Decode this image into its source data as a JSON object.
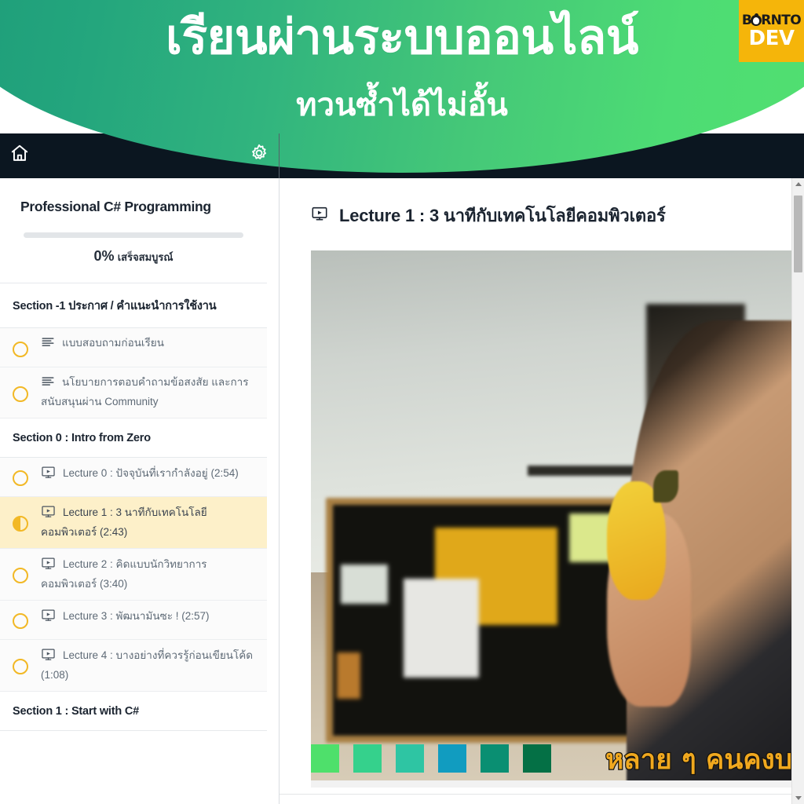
{
  "banner": {
    "title": "เรียนผ่านระบบออนไลน์",
    "subtitle": "ทวนซ้ำได้ไม่อั้น",
    "logo": {
      "line1_pre": "B",
      "line1_post": "RNTO",
      "line2": "DEV",
      "bg_color": "#f5b50a"
    },
    "gradient_from": "#1d9b78",
    "gradient_to": "#52e06f"
  },
  "header": {
    "home_icon": "home-icon",
    "settings_icon": "gear-icon"
  },
  "sidebar": {
    "course_title": "Professional C# Programming",
    "progress": {
      "percent_label": "0%",
      "percent_value": 0,
      "status_text": "เสร็จสมบูรณ์"
    },
    "sections": [
      {
        "heading": "Section -1 ประกาศ / คำแนะนำการใช้งาน",
        "lessons": [
          {
            "icon": "document-icon",
            "label": "แบบสอบถามก่อนเรียน",
            "state": "not-started",
            "active": false
          },
          {
            "icon": "document-icon",
            "label": "นโยบายการตอบคำถามข้อสงสัย และการสนับสนุนผ่าน Community",
            "state": "not-started",
            "active": false
          }
        ]
      },
      {
        "heading": "Section 0 : Intro from Zero",
        "lessons": [
          {
            "icon": "video-icon",
            "label": "Lecture 0 : ปัจจุบันที่เรากำลังอยู่ (2:54)",
            "state": "not-started",
            "active": false
          },
          {
            "icon": "video-icon",
            "label": "Lecture 1 : 3 นาทีกับเทคโนโลยีคอมพิวเตอร์ (2:43)",
            "state": "in-progress",
            "active": true
          },
          {
            "icon": "video-icon",
            "label": "Lecture 2 : คิดแบบนักวิทยาการคอมพิวเตอร์ (3:40)",
            "state": "not-started",
            "active": false
          },
          {
            "icon": "video-icon",
            "label": "Lecture 3 : พัฒนามันซะ ! (2:57)",
            "state": "not-started",
            "active": false
          },
          {
            "icon": "video-icon",
            "label": "Lecture 4 : บางอย่างที่ควรรู้ก่อนเขียนโค้ด (1:08)",
            "state": "not-started",
            "active": false
          }
        ]
      },
      {
        "heading": "Section 1 : Start with C#",
        "lessons": []
      }
    ],
    "accent_color": "#f2b825",
    "active_row_color": "#fdf0c9"
  },
  "main": {
    "lecture_icon": "video-icon",
    "lecture_title": "Lecture 1 : 3 นาทีกับเทคโนโลยีคอมพิวเตอร์",
    "video": {
      "subtitle_text": "หลาย ๆ คนคงบอ",
      "swatches": [
        "#4ee06b",
        "#35d18c",
        "#2ec5a3",
        "#119cc0",
        "#0a8f72",
        "#047045"
      ]
    }
  },
  "scrollbar": {
    "up_arrow": "triangle-up-icon",
    "down_arrow": "triangle-down-icon"
  }
}
